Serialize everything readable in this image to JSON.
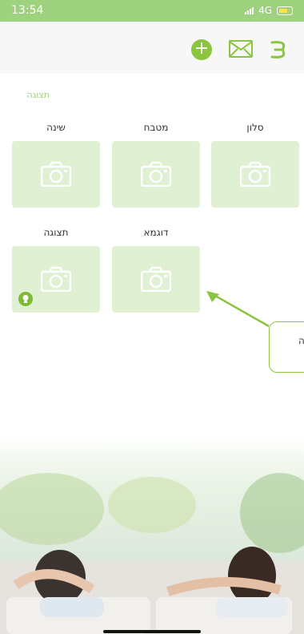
{
  "status_bar": {
    "time": "13:54",
    "network": "4G"
  },
  "header": {
    "add": "add-icon",
    "mail": "mail-icon",
    "menu": "menu-icon"
  },
  "section_title": "תצוגה",
  "rooms": [
    {
      "label": "סלון"
    },
    {
      "label": "מטבח"
    },
    {
      "label": "שינה"
    },
    {
      "label": "דוגמא"
    },
    {
      "label": "תצוגה",
      "has_bulb": true
    }
  ],
  "callout": {
    "text": "ה"
  },
  "colors": {
    "accent": "#8bc53f",
    "statusbar": "#9fd27f",
    "tile": "#dff0d3"
  }
}
